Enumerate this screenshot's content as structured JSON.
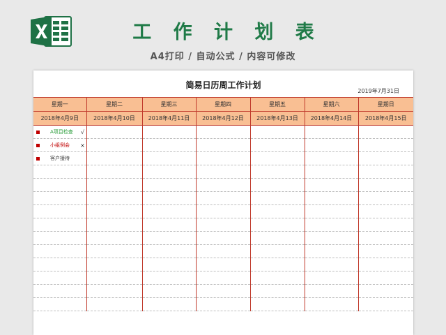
{
  "header": {
    "title": "工 作 计 划 表",
    "subtitle": "A4打印 / 自动公式 / 内容可修改",
    "logo_icon": "excel-icon",
    "accent": "#1f7a47"
  },
  "sheet": {
    "title": "简易日历周工作计划",
    "date": "2019年7月31日",
    "days": [
      "星期一",
      "星期二",
      "星期三",
      "星期四",
      "星期五",
      "星期六",
      "星期日"
    ],
    "dates": [
      "2018年4月9日",
      "2018年4月10日",
      "2018年4月11日",
      "2018年4月12日",
      "2018年4月13日",
      "2018年4月14日",
      "2018年4月15日"
    ],
    "tasks": [
      {
        "label": "A项目检查",
        "mark": "√",
        "color": "#2a9d3a"
      },
      {
        "label": "小组例会",
        "mark": "×",
        "color": "#c00000"
      },
      {
        "label": "客户接待",
        "mark": "",
        "color": "#333333"
      }
    ],
    "header_color": "#f9bf93",
    "line_color": "#c0392b"
  }
}
